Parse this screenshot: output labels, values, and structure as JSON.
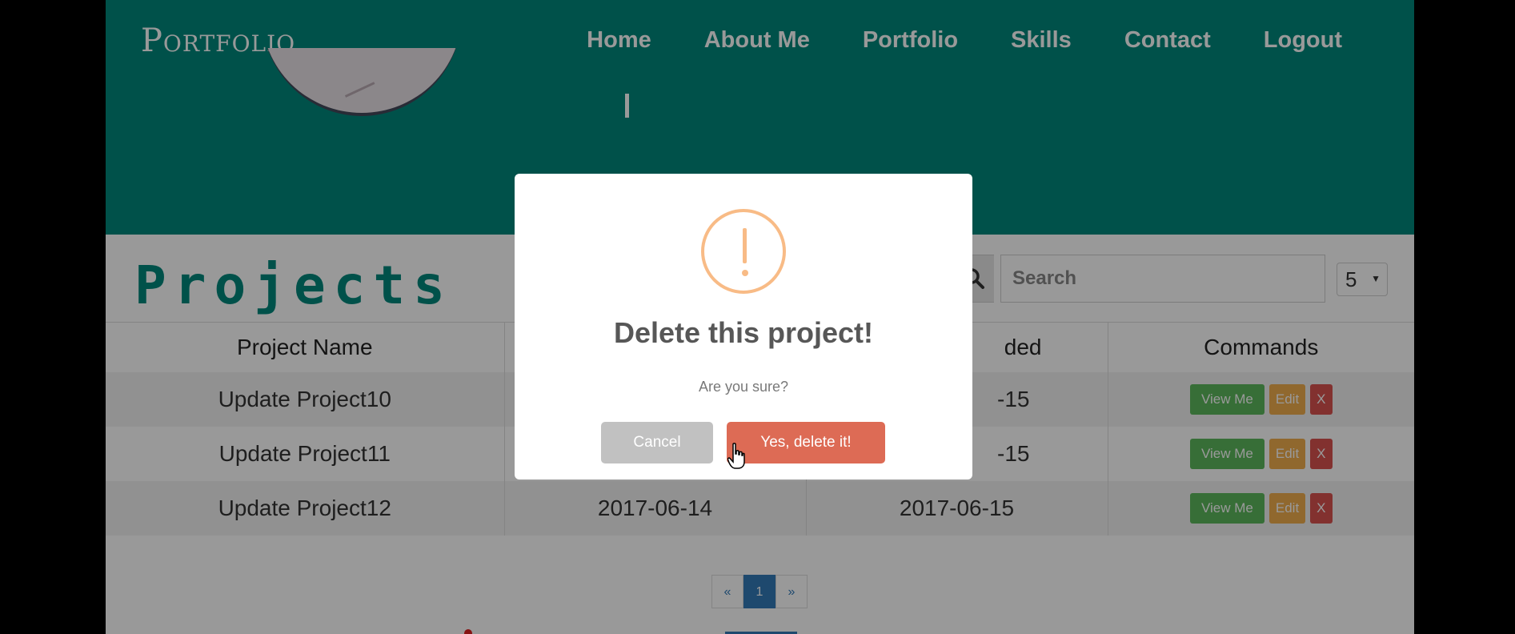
{
  "header": {
    "brand": "Portfolio",
    "nav": [
      "Home",
      "About Me",
      "Portfolio",
      "Skills",
      "Contact",
      "Logout"
    ]
  },
  "projects": {
    "title": "Projects",
    "search_placeholder": "Search",
    "page_size": "5",
    "columns": [
      "Project Name",
      "",
      "ded",
      "Commands"
    ],
    "rows": [
      {
        "name": "Update Project10",
        "date1": "",
        "date2": "-15"
      },
      {
        "name": "Update Project11",
        "date1": "",
        "date2": "-15"
      },
      {
        "name": "Update Project12",
        "date1": "2017-06-14",
        "date2": "2017-06-15"
      }
    ],
    "commands": {
      "view": "View Me",
      "edit": "Edit",
      "delete": "X"
    },
    "pagination": {
      "prev": "«",
      "current": "1",
      "next": "»"
    }
  },
  "dialog": {
    "icon": "warning-exclamation-icon",
    "title": "Delete this project!",
    "text": "Are you sure?",
    "cancel_label": "Cancel",
    "confirm_label": "Yes, delete it!"
  },
  "colors": {
    "header_bg": "#00877c",
    "confirm": "#dd6b55",
    "cancel": "#c1c1c1",
    "warning": "#f8bb86",
    "view": "#5cb85c",
    "edit": "#f0ad4e",
    "delete": "#d9534f"
  }
}
